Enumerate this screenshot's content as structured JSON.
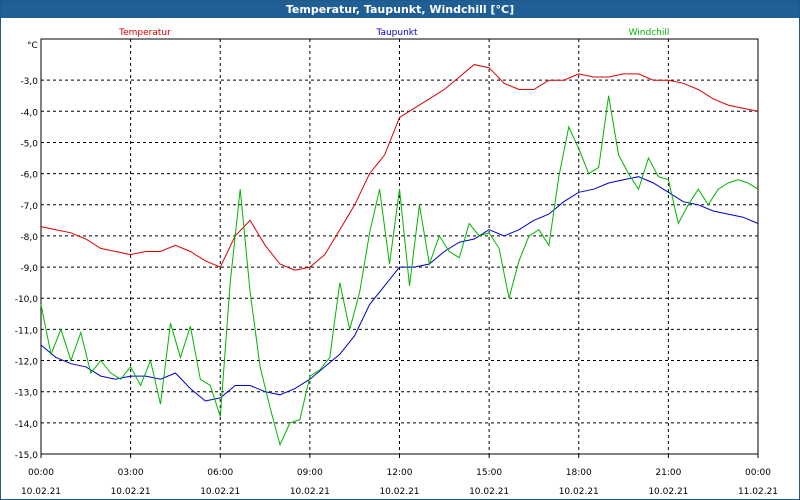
{
  "window": {
    "title": "Temperatur, Taupunkt, Windchill [°C]"
  },
  "colors": {
    "temperature": "#dd0000",
    "dewpoint": "#0000c8",
    "windchill": "#00b400",
    "grid": "#000000"
  },
  "chart_data": {
    "type": "line",
    "title": "Temperatur, Taupunkt, Windchill [°C]",
    "ylabel": "°C",
    "ylim": [
      -15.0,
      -2.0
    ],
    "xlim": [
      "10.02.21 00:00",
      "11.02.21 00:00"
    ],
    "grid": true,
    "legend_placement": "top",
    "y_ticks": [
      "-3,0",
      "-4,0",
      "-5,0",
      "-6,0",
      "-7,0",
      "-8,0",
      "-9,0",
      "-10,0",
      "-11,0",
      "-12,0",
      "-13,0",
      "-14,0",
      "-15,0"
    ],
    "x_ticks": [
      {
        "time": "00:00",
        "date": "10.02.21"
      },
      {
        "time": "03:00",
        "date": "10.02.21"
      },
      {
        "time": "06:00",
        "date": "10.02.21"
      },
      {
        "time": "09:00",
        "date": "10.02.21"
      },
      {
        "time": "12:00",
        "date": "10.02.21"
      },
      {
        "time": "15:00",
        "date": "10.02.21"
      },
      {
        "time": "18:00",
        "date": "10.02.21"
      },
      {
        "time": "21:00",
        "date": "10.02.21"
      },
      {
        "time": "00:00",
        "date": "11.02.21"
      }
    ],
    "series": [
      {
        "name": "Temperatur",
        "x": [
          "00:00",
          "00:30",
          "01:00",
          "01:30",
          "02:00",
          "02:30",
          "03:00",
          "03:30",
          "04:00",
          "04:30",
          "05:00",
          "05:30",
          "06:00",
          "06:30",
          "07:00",
          "07:30",
          "08:00",
          "08:30",
          "09:00",
          "09:30",
          "10:00",
          "10:30",
          "11:00",
          "11:30",
          "12:00",
          "12:30",
          "13:00",
          "13:30",
          "14:00",
          "14:30",
          "15:00",
          "15:30",
          "16:00",
          "16:30",
          "17:00",
          "17:30",
          "18:00",
          "18:30",
          "19:00",
          "19:30",
          "20:00",
          "20:30",
          "21:00",
          "21:30",
          "22:00",
          "22:30",
          "23:00",
          "23:30",
          "24:00"
        ],
        "values": [
          -7.7,
          -7.8,
          -7.9,
          -8.1,
          -8.4,
          -8.5,
          -8.6,
          -8.5,
          -8.5,
          -8.3,
          -8.5,
          -8.8,
          -9.0,
          -8.0,
          -7.5,
          -8.3,
          -8.9,
          -9.1,
          -9.0,
          -8.6,
          -7.8,
          -7.0,
          -6.0,
          -5.4,
          -4.2,
          -3.9,
          -3.6,
          -3.3,
          -2.9,
          -2.5,
          -2.6,
          -3.1,
          -3.3,
          -3.3,
          -3.0,
          -3.0,
          -2.8,
          -2.9,
          -2.9,
          -2.8,
          -2.8,
          -3.0,
          -3.0,
          -3.1,
          -3.3,
          -3.6,
          -3.8,
          -3.9,
          -4.0
        ]
      },
      {
        "name": "Taupunkt",
        "x": [
          "00:00",
          "00:30",
          "01:00",
          "01:30",
          "02:00",
          "02:30",
          "03:00",
          "03:30",
          "04:00",
          "04:30",
          "05:00",
          "05:30",
          "06:00",
          "06:30",
          "07:00",
          "07:30",
          "08:00",
          "08:30",
          "09:00",
          "09:30",
          "10:00",
          "10:30",
          "11:00",
          "11:30",
          "12:00",
          "12:30",
          "13:00",
          "13:30",
          "14:00",
          "14:30",
          "15:00",
          "15:30",
          "16:00",
          "16:30",
          "17:00",
          "17:30",
          "18:00",
          "18:30",
          "19:00",
          "19:30",
          "20:00",
          "20:30",
          "21:00",
          "21:30",
          "22:00",
          "22:30",
          "23:00",
          "23:30",
          "24:00"
        ],
        "values": [
          -11.5,
          -11.9,
          -12.1,
          -12.2,
          -12.5,
          -12.6,
          -12.5,
          -12.5,
          -12.6,
          -12.4,
          -12.9,
          -13.3,
          -13.2,
          -12.8,
          -12.8,
          -13.0,
          -13.1,
          -12.9,
          -12.6,
          -12.2,
          -11.8,
          -11.2,
          -10.2,
          -9.6,
          -9.0,
          -9.0,
          -8.9,
          -8.5,
          -8.2,
          -8.1,
          -7.8,
          -8.0,
          -7.8,
          -7.5,
          -7.3,
          -6.9,
          -6.6,
          -6.5,
          -6.3,
          -6.2,
          -6.1,
          -6.3,
          -6.6,
          -6.9,
          -7.0,
          -7.2,
          -7.3,
          -7.4,
          -7.6
        ]
      },
      {
        "name": "Windchill",
        "x": [
          "00:00",
          "00:20",
          "00:40",
          "01:00",
          "01:20",
          "01:40",
          "02:00",
          "02:20",
          "02:40",
          "03:00",
          "03:20",
          "03:40",
          "04:00",
          "04:20",
          "04:40",
          "05:00",
          "05:20",
          "05:40",
          "06:00",
          "06:20",
          "06:40",
          "07:00",
          "07:20",
          "07:40",
          "08:00",
          "08:20",
          "08:40",
          "09:00",
          "09:20",
          "09:40",
          "10:00",
          "10:20",
          "10:40",
          "11:00",
          "11:20",
          "11:40",
          "12:00",
          "12:20",
          "12:40",
          "13:00",
          "13:20",
          "13:40",
          "14:00",
          "14:20",
          "14:40",
          "15:00",
          "15:20",
          "15:40",
          "16:00",
          "16:20",
          "16:40",
          "17:00",
          "17:20",
          "17:40",
          "18:00",
          "18:20",
          "18:40",
          "19:00",
          "19:20",
          "19:40",
          "20:00",
          "20:20",
          "20:40",
          "21:00",
          "21:20",
          "21:40",
          "22:00",
          "22:20",
          "22:40",
          "23:00",
          "23:20",
          "23:40",
          "24:00"
        ],
        "values": [
          -10.2,
          -11.8,
          -11.0,
          -12.0,
          -11.1,
          -12.4,
          -12.0,
          -12.4,
          -12.6,
          -12.2,
          -12.8,
          -12.0,
          -13.4,
          -10.8,
          -11.9,
          -10.9,
          -12.6,
          -12.8,
          -13.8,
          -9.5,
          -6.5,
          -9.8,
          -12.2,
          -13.5,
          -14.7,
          -14.0,
          -13.9,
          -12.5,
          -12.3,
          -11.9,
          -9.5,
          -11.0,
          -9.8,
          -7.9,
          -6.5,
          -8.9,
          -6.5,
          -9.6,
          -7.0,
          -8.9,
          -8.0,
          -8.5,
          -8.7,
          -7.6,
          -8.0,
          -7.9,
          -8.4,
          -10.0,
          -8.8,
          -8.0,
          -7.8,
          -8.3,
          -6.1,
          -4.5,
          -5.2,
          -6.0,
          -5.8,
          -3.5,
          -5.4,
          -6.0,
          -6.5,
          -5.5,
          -6.1,
          -6.2,
          -7.6,
          -7.0,
          -6.5,
          -7.0,
          -6.5,
          -6.3,
          -6.2,
          -6.3,
          -6.5
        ]
      }
    ]
  }
}
